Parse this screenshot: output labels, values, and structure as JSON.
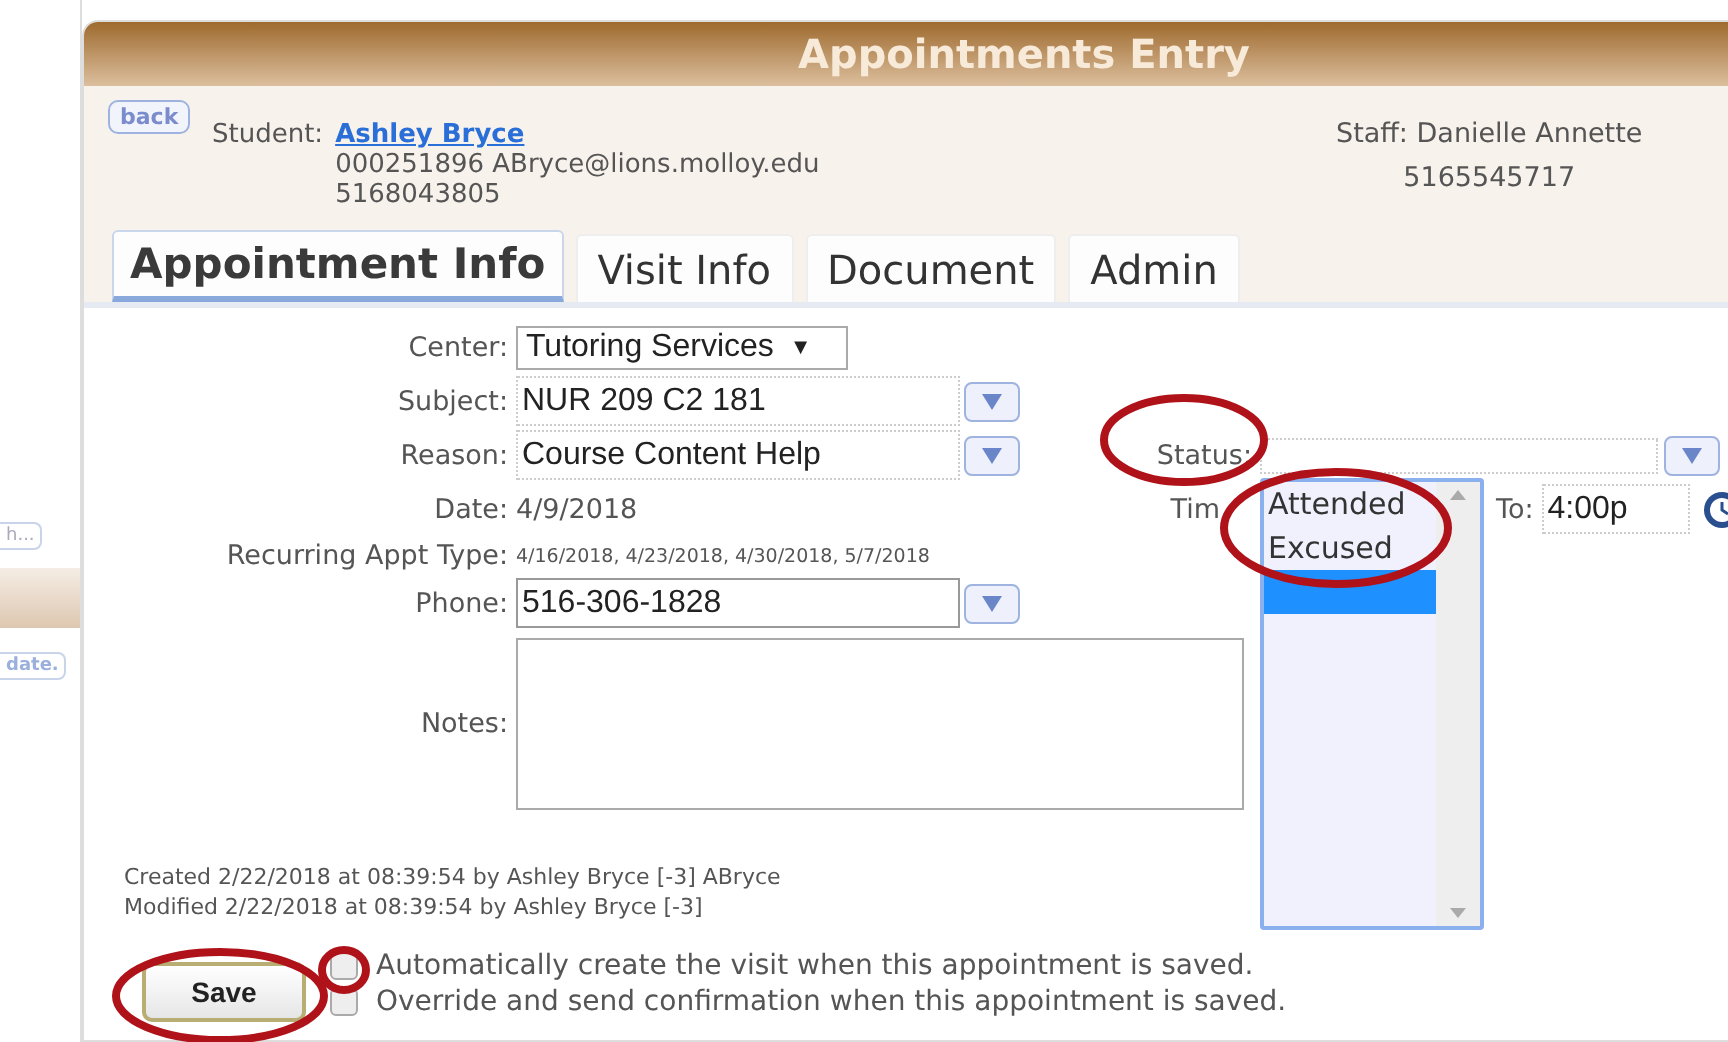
{
  "background_page": {
    "button_1": "h...",
    "button_2": "date."
  },
  "window": {
    "title": "Appointments Entry"
  },
  "header": {
    "back": "back",
    "student_label": "Student:",
    "student_name": "Ashley Bryce",
    "student_id_email": "000251896 ABryce@lions.molloy.edu",
    "student_phone": "5168043805",
    "staff": "Staff: Danielle Annette",
    "staff_phone": "5165545717"
  },
  "tabs": [
    {
      "label": "Appointment Info",
      "selected": true
    },
    {
      "label": "Visit Info",
      "selected": false
    },
    {
      "label": "Document",
      "selected": false
    },
    {
      "label": "Admin",
      "selected": false
    }
  ],
  "form": {
    "center_label": "Center:",
    "center": "Tutoring Services",
    "center_caret": "▼",
    "subject_label": "Subject:",
    "subject": "NUR  209 C2 181",
    "reason_label": "Reason:",
    "reason": "Course Content Help",
    "status_label": "Status:",
    "date_label": "Date:",
    "date": "4/9/2018",
    "time_label": "Tim",
    "to_label": "To:",
    "to": "4:00p",
    "recurring_label": "Recurring Appt Type:",
    "recurring": "4/16/2018, 4/23/2018, 4/30/2018, 5/7/2018",
    "phone_label": "Phone:",
    "phone": "516-306-1828",
    "notes_label": "Notes:"
  },
  "status_options": [
    {
      "label": "Attended",
      "selected": false
    },
    {
      "label": "Excused",
      "selected": false
    },
    {
      "selected": true
    }
  ],
  "meta": [
    "Created 2/22/2018 at 08:39:54 by Ashley Bryce [-3] ABryce",
    "Modified 2/22/2018 at 08:39:54 by Ashley Bryce [-3]"
  ],
  "save": "Save",
  "options": [
    {
      "label": "Automatically create the visit when this appointment is saved.",
      "checked": false
    },
    {
      "label": "Override and send confirmation when this appointment is saved.",
      "checked": false
    }
  ]
}
